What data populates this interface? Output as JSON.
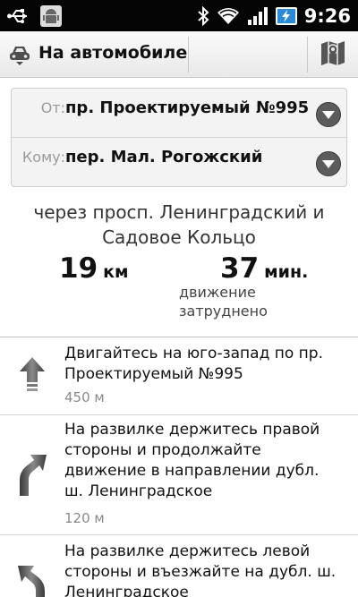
{
  "status_bar": {
    "time": "9:26",
    "icons": [
      "usb-icon",
      "android-debug-icon",
      "bluetooth-icon",
      "wifi-icon",
      "signal-icon",
      "battery-charging-icon"
    ]
  },
  "action_bar": {
    "mode_label": "На автомобиле",
    "mode_icon": "car-icon",
    "map_icon": "map-icon"
  },
  "route": {
    "from_label": "От:",
    "from_value": "пр. Проектируемый №995",
    "to_label": "Кому:",
    "to_value": "пер. Мал. Рогожский"
  },
  "summary": {
    "via_line1": "через просп. Ленинградский и",
    "via_line2": "Садовое Кольцо",
    "distance_value": "19",
    "distance_unit": "км",
    "time_value": "37",
    "time_unit": "мин.",
    "traffic_line1": "движение",
    "traffic_line2": "затруднено"
  },
  "steps": [
    {
      "icon": "straight-arrow-icon",
      "lines": [
        "Двигайтесь на юго-запад по пр.",
        "Проектируемый №995"
      ],
      "distance": "450 м"
    },
    {
      "icon": "fork-right-icon",
      "lines": [
        "На развилке держитесь правой",
        "стороны и продолжайте",
        "движение в направлении дубл.",
        "ш. Ленинградское"
      ],
      "distance": "120 м"
    },
    {
      "icon": "fork-left-icon",
      "lines": [
        "На развилке держитесь левой",
        "стороны и въезжайте на дубл. ш.",
        "Ленинградское"
      ],
      "distance": ""
    }
  ],
  "colors": {
    "status_bar_bg": "#050505",
    "battery_accent": "#2b8ad8",
    "icon_gray": "#5c5c5c"
  }
}
